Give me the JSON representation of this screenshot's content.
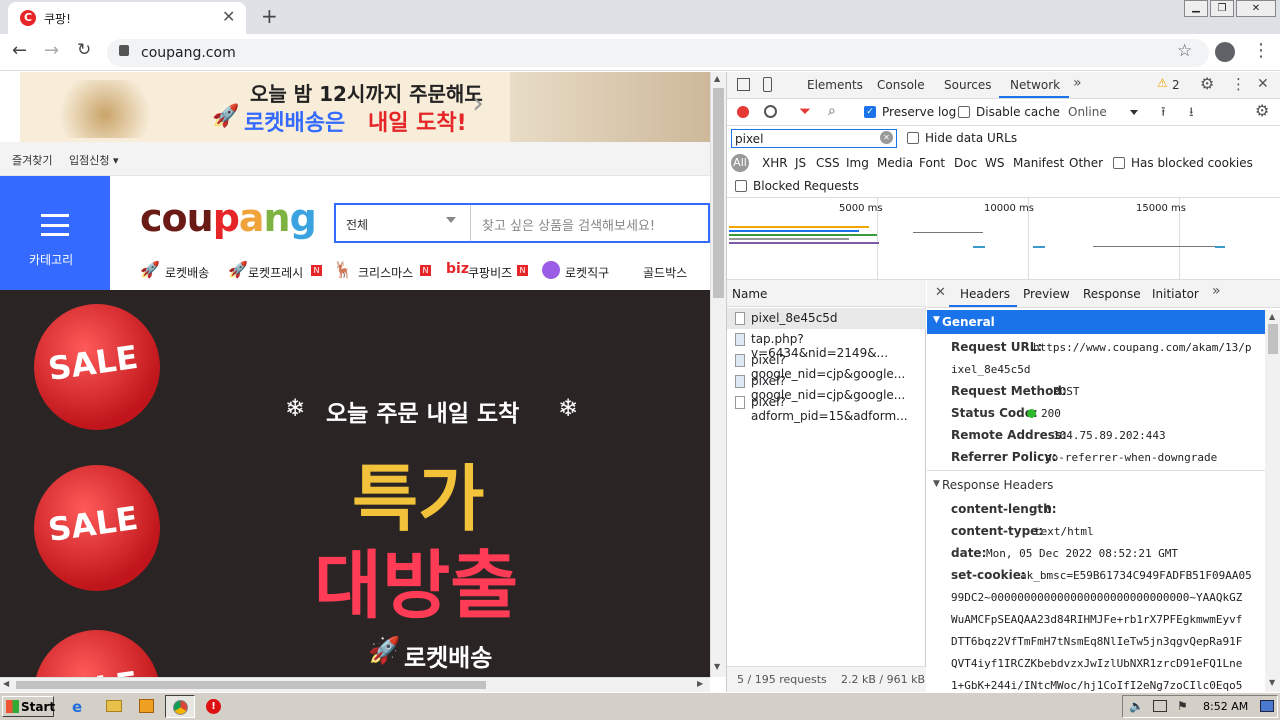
{
  "browser": {
    "tab_title": "쿠팡!",
    "url": "coupang.com",
    "favicon_letter": "C"
  },
  "page": {
    "banner_line1": "오늘 밤 12시까지 주문해도",
    "banner_line2_a": "로켓배송은 ",
    "banner_line2_b": "내일 도착!",
    "top_links": [
      "즐겨찾기",
      "입점신청 ▾"
    ],
    "category_label": "카테고리",
    "logo": "coupang",
    "search_select": "전체",
    "search_placeholder": "찾고 싶은 상품을 검색해보세요!",
    "nav": [
      "로켓배송",
      "로켓프레시",
      "크리스마스",
      "쿠팡비즈",
      "로켓직구",
      "골드박스"
    ],
    "biz_prefix": "biz",
    "promo_line1": "오늘 주문 내일 도착",
    "promo_big1": "특가",
    "promo_big2": "대방출",
    "promo_rocket": "로켓배송",
    "sale": "SALE"
  },
  "devtools": {
    "tabs": [
      "Elements",
      "Console",
      "Sources",
      "Network"
    ],
    "warning_count": "2",
    "preserve_log": "Preserve log",
    "disable_cache": "Disable cache",
    "throttle": "Online",
    "filter_value": "pixel",
    "hide_data_urls": "Hide data URLs",
    "types": [
      "All",
      "XHR",
      "JS",
      "CSS",
      "Img",
      "Media",
      "Font",
      "Doc",
      "WS",
      "Manifest",
      "Other"
    ],
    "has_blocked_cookies": "Has blocked cookies",
    "blocked_requests": "Blocked Requests",
    "timeline_ticks": [
      "5000 ms",
      "10000 ms",
      "15000 ms"
    ],
    "name_header": "Name",
    "requests": [
      "pixel_8e45c5d",
      "tap.php?v=6434&nid=2149&...",
      "pixel?google_nid=cjp&google...",
      "pixel?google_nid=cjp&google...",
      "pixel?adform_pid=15&adform..."
    ],
    "footer_requests": "5 / 195 requests",
    "footer_size": "2.2 kB / 961 kB",
    "detail_tabs": [
      "Headers",
      "Preview",
      "Response",
      "Initiator"
    ],
    "general_title": "General",
    "general": [
      {
        "k": "Request URL:",
        "v": "https://www.coupang.com/akam/13/p"
      },
      {
        "k": "",
        "v": "ixel_8e45c5d"
      },
      {
        "k": "Request Method:",
        "v": "POST"
      },
      {
        "k": "Status Code:",
        "v": "200"
      },
      {
        "k": "Remote Address:",
        "v": "104.75.89.202:443"
      },
      {
        "k": "Referrer Policy:",
        "v": "no-referrer-when-downgrade"
      }
    ],
    "response_title": "Response Headers",
    "response": [
      {
        "k": "content-length:",
        "v": "0"
      },
      {
        "k": "content-type:",
        "v": "text/html"
      },
      {
        "k": "date:",
        "v": "Mon, 05 Dec 2022 08:52:21 GMT"
      },
      {
        "k": "set-cookie:",
        "v": "ak_bmsc=E59B61734C949FADFB51F09AA05"
      }
    ],
    "cookie_lines": [
      "99DC2~000000000000000000000000000000~YAAQkGZ",
      "WuAMCFpSEAQAA23d84RIHMJFe+rb1rX7PFEgkmwmEyvf",
      "DTT6bqz2VfTmFmH7tNsmEq8NlIeTw5jn3qgvQepRa91F",
      "QVT4iyf1IRCZKbebdvzxJwIzlUbNXR1zrcD91eFQ1Lne",
      "1+GbK+244i/INtcMWoc/hj1CoIfI2eNg7zoCIlc0Eqo5"
    ]
  },
  "taskbar": {
    "start": "Start",
    "time": "8:52 AM"
  },
  "colors": {
    "accent_blue": "#346aff",
    "coupang_red": "#e52528",
    "network_underline": "#1a73e8",
    "devtools_selected": "#1a73e8"
  }
}
